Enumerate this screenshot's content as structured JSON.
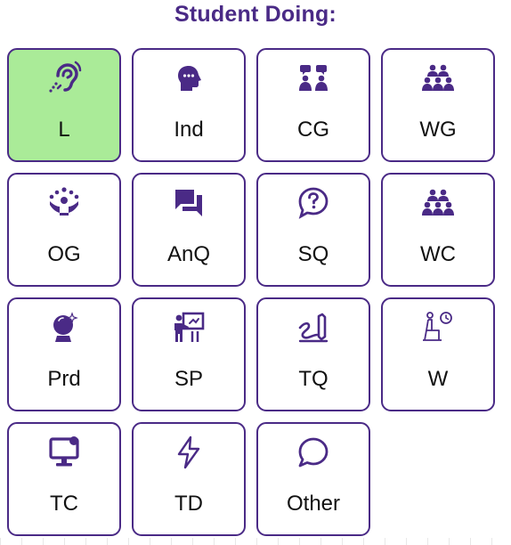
{
  "header": {
    "title": "Student Doing:"
  },
  "accent_color": "#4a2a86",
  "selected_color": "#aaeb98",
  "tiles": [
    {
      "label": "L",
      "icon": "ear-listening-icon",
      "selected": true
    },
    {
      "label": "Ind",
      "icon": "head-thinking-icon",
      "selected": false
    },
    {
      "label": "CG",
      "icon": "small-group-icon",
      "selected": false
    },
    {
      "label": "WG",
      "icon": "whole-group-icon",
      "selected": false
    },
    {
      "label": "OG",
      "icon": "group-raising-hands-icon",
      "selected": false
    },
    {
      "label": "AnQ",
      "icon": "chat-bubbles-icon",
      "selected": false
    },
    {
      "label": "SQ",
      "icon": "question-bubble-icon",
      "selected": false
    },
    {
      "label": "WC",
      "icon": "whole-class-icon",
      "selected": false
    },
    {
      "label": "Prd",
      "icon": "crystal-ball-icon",
      "selected": false
    },
    {
      "label": "SP",
      "icon": "student-presenting-icon",
      "selected": false
    },
    {
      "label": "TQ",
      "icon": "pencil-writing-icon",
      "selected": false
    },
    {
      "label": "W",
      "icon": "waiting-person-clock-icon",
      "selected": false
    },
    {
      "label": "TC",
      "icon": "computer-monitor-icon",
      "selected": false
    },
    {
      "label": "TD",
      "icon": "lightning-icon",
      "selected": false
    },
    {
      "label": "Other",
      "icon": "speech-bubble-icon",
      "selected": false
    }
  ]
}
